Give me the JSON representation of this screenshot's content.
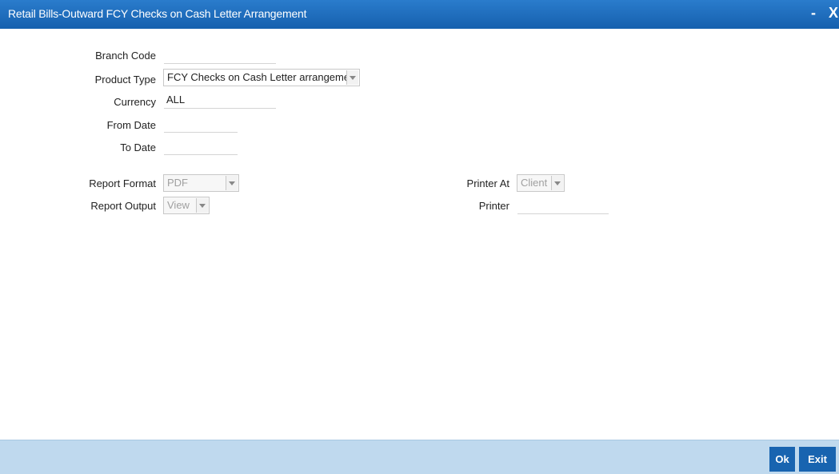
{
  "window": {
    "title": "Retail Bills-Outward FCY Checks on Cash Letter Arrangement",
    "minimize_label": "-",
    "close_label": "X"
  },
  "form": {
    "branch_code": {
      "label": "Branch Code",
      "value": ""
    },
    "product_type": {
      "label": "Product Type",
      "value": "FCY Checks on Cash Letter arrangement"
    },
    "currency": {
      "label": "Currency",
      "value": "ALL"
    },
    "from_date": {
      "label": "From Date",
      "value": ""
    },
    "to_date": {
      "label": "To Date",
      "value": ""
    },
    "report_format": {
      "label": "Report Format",
      "value": "PDF"
    },
    "report_output": {
      "label": "Report Output",
      "value": "View"
    },
    "printer_at": {
      "label": "Printer At",
      "value": "Client"
    },
    "printer": {
      "label": "Printer",
      "value": ""
    }
  },
  "footer": {
    "ok_label": "Ok",
    "exit_label": "Exit"
  },
  "colors": {
    "titlebar": "#1a68b8",
    "footer": "#bfd9ee",
    "button": "#1864b0"
  }
}
